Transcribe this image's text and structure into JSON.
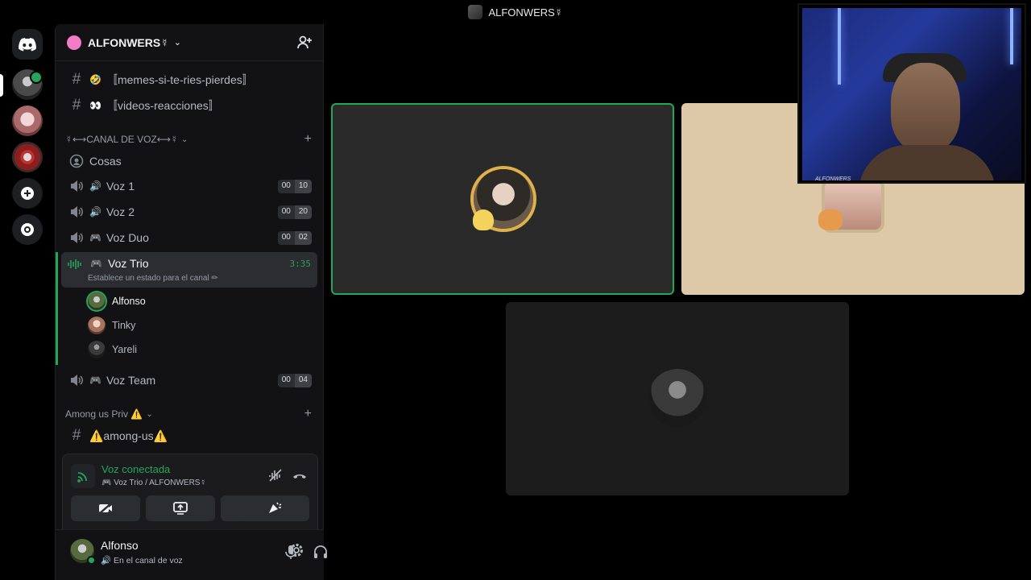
{
  "window": {
    "title": "ALFONWERS☿"
  },
  "server": {
    "name": "ALFONWERS☿"
  },
  "text_channels": [
    {
      "name": "〚memes-si-te-ries-pierdes〛",
      "emoji": "🤣"
    },
    {
      "name": "〚videos-reacciones〛",
      "emoji": "👀"
    }
  ],
  "voice_category": {
    "label": "☿⟷CANAL DE VOZ⟷☿"
  },
  "voice_channels": [
    {
      "name": "Cosas"
    },
    {
      "name": "Voz 1",
      "emoji": "🔊",
      "count": "00",
      "limit": "10"
    },
    {
      "name": "Voz 2",
      "emoji": "🔊",
      "count": "00",
      "limit": "20"
    },
    {
      "name": "Voz Duo",
      "emoji": "🎮",
      "count": "00",
      "limit": "02"
    },
    {
      "name": "Voz Trio",
      "emoji": "🎮",
      "timer": "3:35",
      "status": "Establece un estado para el canal ✏"
    },
    {
      "name": "Voz Team",
      "emoji": "🎮",
      "count": "00",
      "limit": "04"
    }
  ],
  "members": [
    "Alfonso",
    "Tinky",
    "Yareli"
  ],
  "among_category": {
    "label": "Among us Priv ⚠️"
  },
  "among_channel": {
    "name": "⚠️among-us⚠️"
  },
  "voice_panel": {
    "title": "Voz conectada",
    "subtitle": "🎮 Voz Trio / ALFONWERS☿"
  },
  "user": {
    "name": "Alfonso",
    "status": "🔊 En el canal de voz"
  },
  "camera": {
    "caption": "ALFONWERS"
  },
  "colors": {
    "accent_green": "#23a55a",
    "brand": "#5865f2"
  },
  "icons": [
    "discord-logo",
    "add-friend",
    "hash",
    "speaker",
    "voice-wave",
    "signal",
    "noise-suppression",
    "hang-up",
    "camera-off",
    "screen-share",
    "activities",
    "soundboard",
    "microphone",
    "headphones",
    "gear"
  ]
}
